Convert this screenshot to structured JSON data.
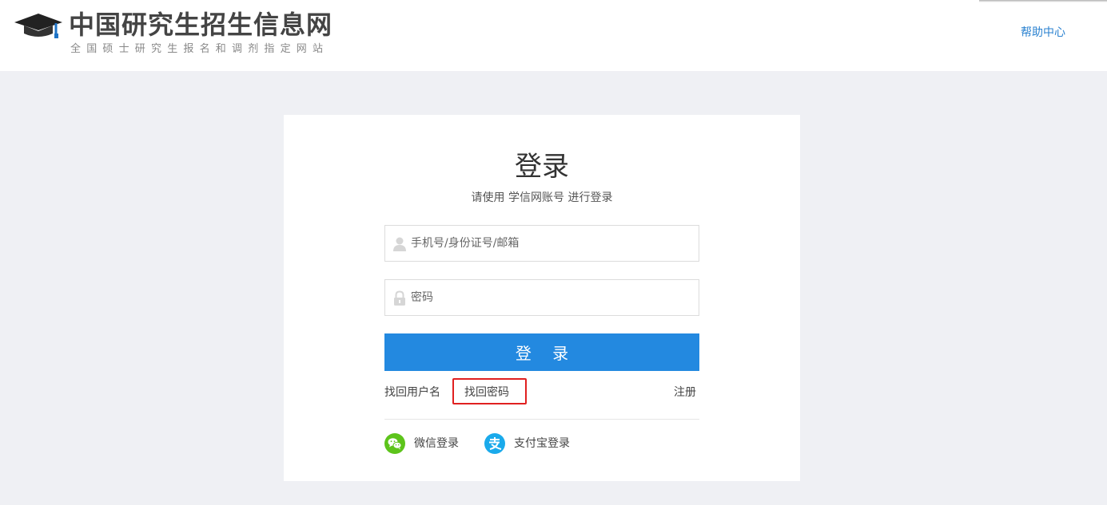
{
  "header": {
    "logo_title": "中国研究生招生信息网",
    "logo_subtitle": "全国硕士研究生报名和调剂指定网站",
    "help_link": "帮助中心"
  },
  "login": {
    "title": "登录",
    "subtitle": "请使用 学信网账号 进行登录",
    "username_placeholder": "手机号/身份证号/邮箱",
    "password_placeholder": "密码",
    "submit_label": "登 录",
    "find_username": "找回用户名",
    "find_password": "找回密码",
    "register": "注册",
    "social": [
      {
        "label": "微信登录",
        "icon": "wechat-icon",
        "color": "#5dc41b"
      },
      {
        "label": "支付宝登录",
        "icon": "alipay-icon",
        "color": "#1aaaeb"
      }
    ]
  },
  "colors": {
    "page_bg": "#eff0f4",
    "primary_button": "#2389e0",
    "link_blue": "#2b82d0",
    "highlight_box": "#e02020"
  }
}
